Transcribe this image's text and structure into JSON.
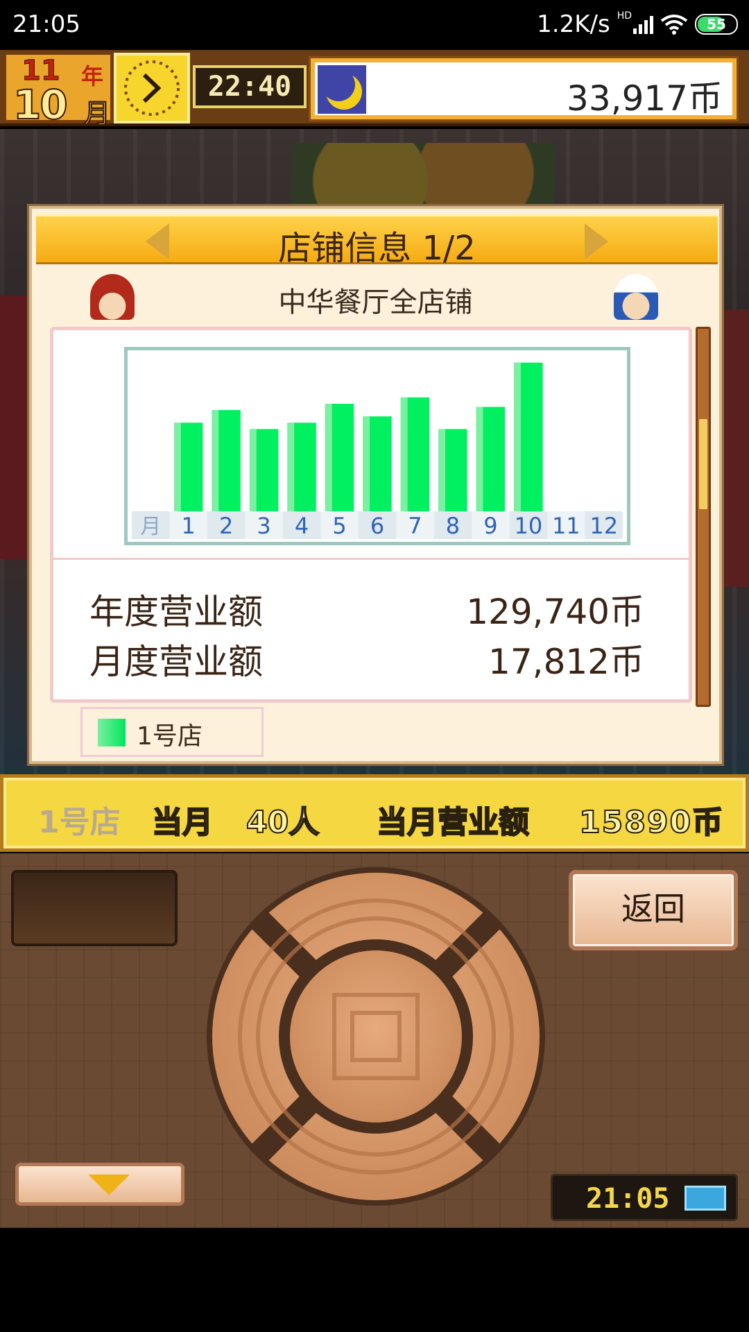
{
  "status_bar": {
    "time": "21:05",
    "speed": "1.2K/s",
    "network": "HD",
    "battery": "55"
  },
  "hud": {
    "year_num": "11",
    "year_label": "年",
    "month_num": "10",
    "month_label": "月",
    "game_time": "22:40",
    "money": "33,917币"
  },
  "panel": {
    "title": "店铺信息 1/2",
    "subtitle": "中华餐厅全店铺",
    "annual_label": "年度营业额",
    "annual_value": "129,740币",
    "monthly_label": "月度营业额",
    "monthly_value": "17,812币",
    "legend": "1号店"
  },
  "chart_data": {
    "type": "bar",
    "categories": [
      "1",
      "2",
      "3",
      "4",
      "5",
      "6",
      "7",
      "8",
      "9",
      "10",
      "11",
      "12"
    ],
    "x_axis_prefix": "月",
    "series": [
      {
        "name": "1号店",
        "values": [
          14,
          16,
          13,
          14,
          17,
          15,
          18,
          13,
          16.5,
          23.5,
          null,
          null
        ],
        "color": "#00f060"
      }
    ],
    "ylim": [
      0,
      25
    ]
  },
  "info_bar": {
    "store": "1号店",
    "month_label": "当月",
    "people": "40人",
    "sales_label": "当月营业额",
    "sales_amount": "15890币"
  },
  "controls": {
    "back_label": "返回",
    "clock": "21:05"
  },
  "colors": {
    "bar": "#00f060",
    "header": "#f5ab13",
    "panel_bg": "#fdf1dc"
  }
}
